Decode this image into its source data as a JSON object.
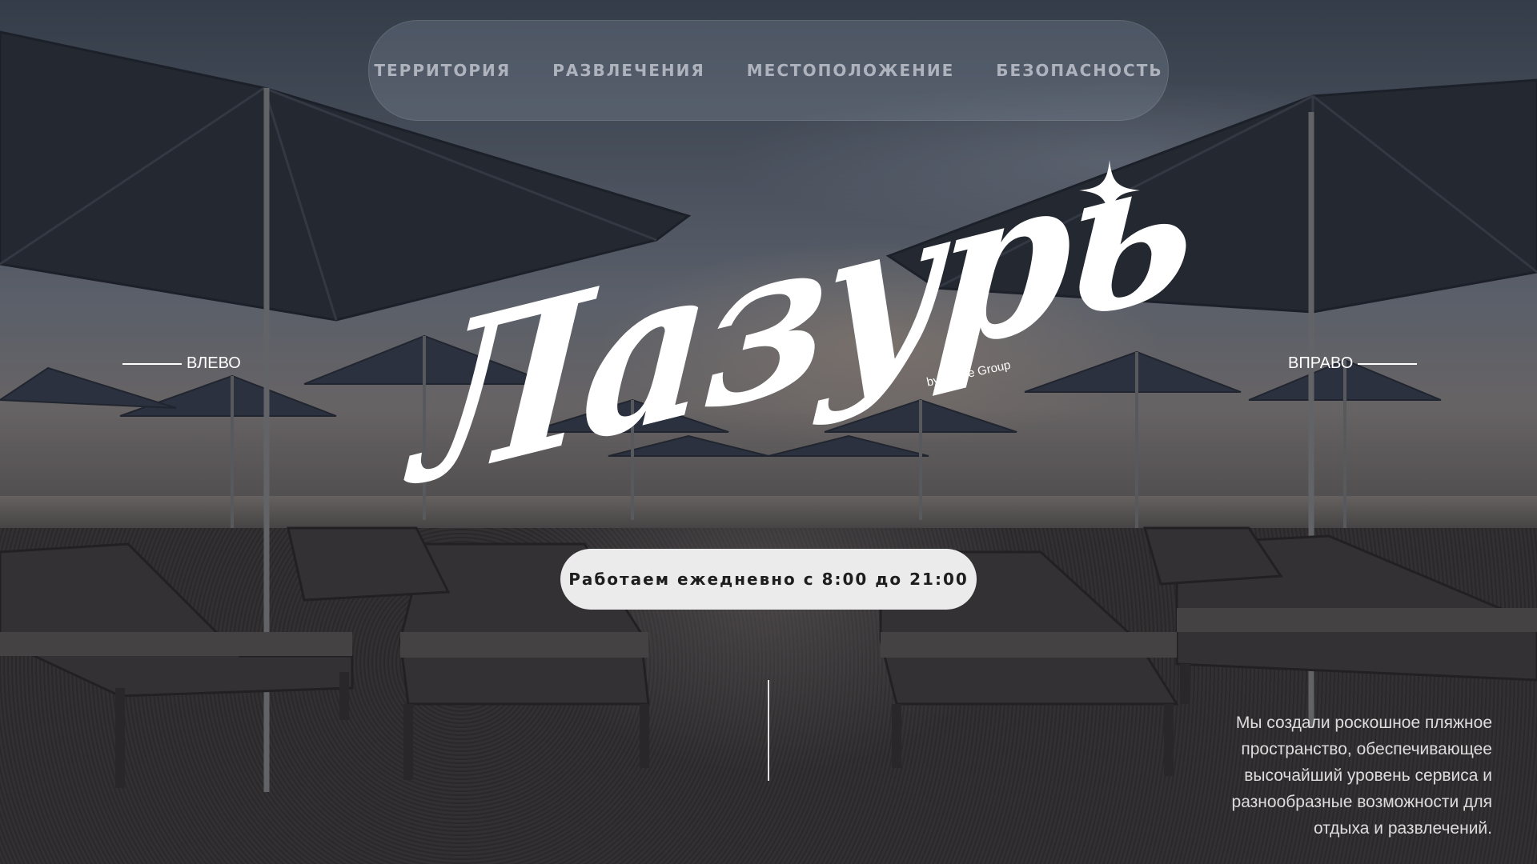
{
  "nav": {
    "items": [
      {
        "label": "ТЕРРИТОРИЯ"
      },
      {
        "label": "РАЗВЛЕЧЕНИЯ"
      },
      {
        "label": "МЕСТОПОЛОЖЕНИЕ"
      },
      {
        "label": "БЕЗОПАСНОСТЬ"
      }
    ]
  },
  "slider": {
    "prev_label": "ВЛЕВО",
    "next_label": "ВПРАВО"
  },
  "logo": {
    "wordmark": "Лазурь",
    "tagline": "by Grace Group"
  },
  "hours": {
    "text": "Работаем ежедневно с 8:00 до 21:00"
  },
  "about": {
    "text": "Мы создали роскошное пляжное пространство, обеспечивающее высочайший уровень сервиса и разнообразные возможности для отдыха и развлечений."
  },
  "colors": {
    "overlay": "#12161e",
    "pill_bg": "#ebebeb",
    "text_light": "#ffffff"
  },
  "icons": {
    "logo_star": "four-point-star-icon"
  }
}
